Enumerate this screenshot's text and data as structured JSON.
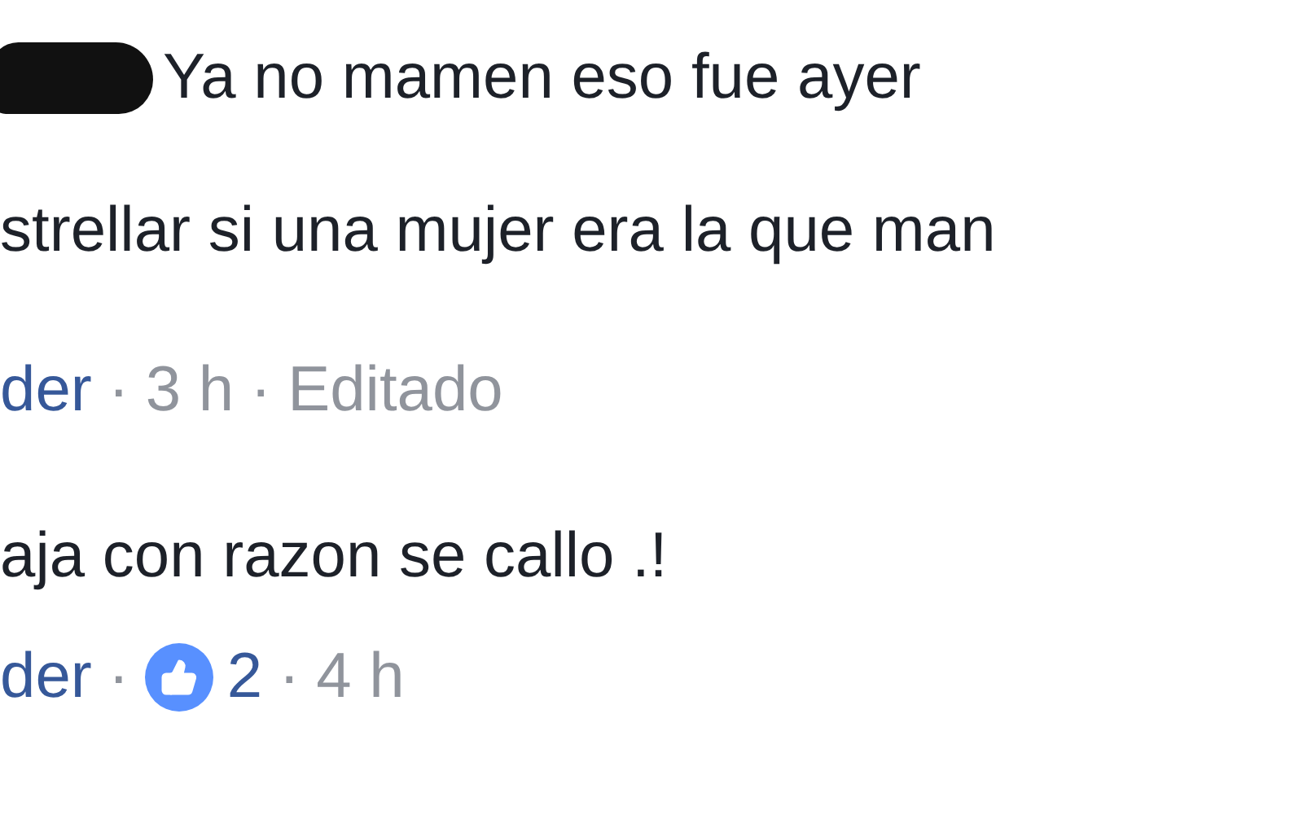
{
  "separator": "·",
  "reply": {
    "text": "Ya no mamen eso fue ayer"
  },
  "comments": [
    {
      "text": "strellar si una mujer era la que man",
      "author": "der",
      "time": "3 h",
      "edited": "Editado"
    },
    {
      "text": "aja con razon se callo .!",
      "author": "der",
      "likes": "2",
      "time": "4 h"
    }
  ]
}
